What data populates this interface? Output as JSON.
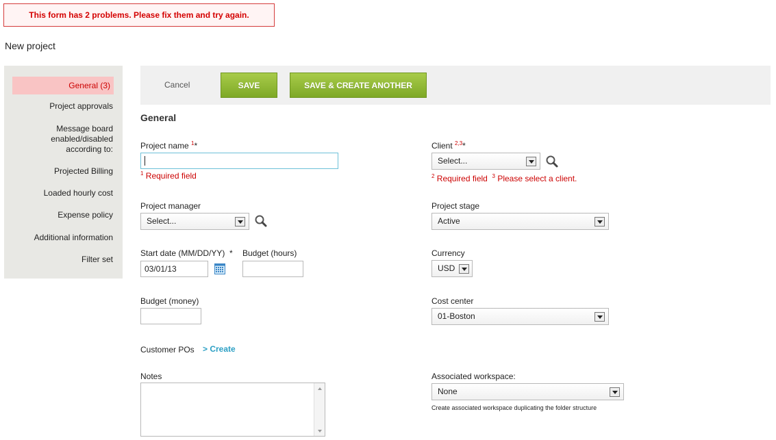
{
  "error_banner": "This form has 2 problems. Please fix them and try again.",
  "page_title": "New project",
  "sidebar": {
    "items": [
      {
        "label": "General (3)"
      },
      {
        "label": "Project approvals"
      },
      {
        "label": "Message board enabled/disabled according to:"
      },
      {
        "label": "Projected Billing"
      },
      {
        "label": "Loaded hourly cost"
      },
      {
        "label": "Expense policy"
      },
      {
        "label": "Additional information"
      },
      {
        "label": "Filter set"
      }
    ]
  },
  "toolbar": {
    "cancel": "Cancel",
    "save": "SAVE",
    "save_create": "SAVE & CREATE ANOTHER"
  },
  "section_title": "General",
  "fields": {
    "project_name": {
      "label": "Project name",
      "marker": "1",
      "required": "*",
      "value": "",
      "error_marker": "1",
      "error": "Required field"
    },
    "client": {
      "label": "Client",
      "marker": "2,3",
      "required": "*",
      "value": "Select...",
      "error1_marker": "2",
      "error1": "Required field",
      "error2_marker": "3",
      "error2": "Please select a client."
    },
    "project_manager": {
      "label": "Project manager",
      "value": "Select..."
    },
    "project_stage": {
      "label": "Project stage",
      "value": "Active"
    },
    "start_date": {
      "label": "Start date (MM/DD/YY)",
      "required": "*",
      "value": "03/01/13"
    },
    "budget_hours": {
      "label": "Budget (hours)",
      "value": ""
    },
    "currency": {
      "label": "Currency",
      "value": "USD"
    },
    "budget_money": {
      "label": "Budget (money)",
      "value": ""
    },
    "cost_center": {
      "label": "Cost center",
      "value": "01-Boston"
    },
    "customer_pos": {
      "label": "Customer POs",
      "link": "> Create"
    },
    "notes": {
      "label": "Notes",
      "value": ""
    },
    "workspace": {
      "label": "Associated workspace:",
      "value": "None",
      "hint": "Create associated workspace duplicating the folder structure"
    }
  },
  "colors": {
    "error": "#cc0000",
    "button_green": "#8db535",
    "link": "#2b9fc4",
    "active_nav_bg": "#f9c4c4"
  }
}
